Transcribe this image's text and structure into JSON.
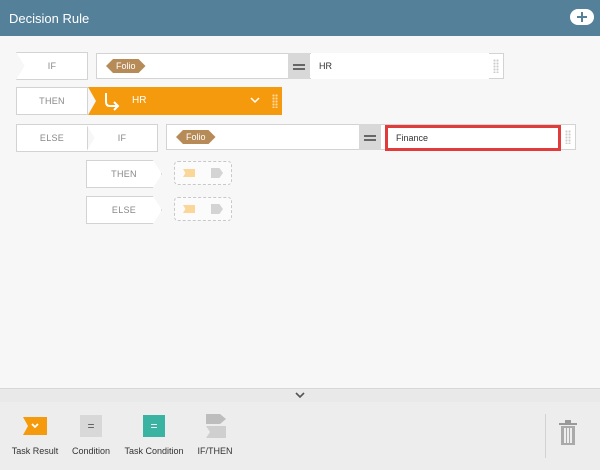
{
  "header": {
    "title": "Decision Rule",
    "add_button_icon": "plus-icon"
  },
  "rule": {
    "if_label": "IF",
    "then_label": "THEN",
    "else_label": "ELSE",
    "condition1": {
      "field": "Folio",
      "operator": "=",
      "value": "HR"
    },
    "then_result": "HR",
    "nested": {
      "if_label": "IF",
      "then_label": "THEN",
      "else_label": "ELSE",
      "condition": {
        "field": "Folio",
        "operator": "=",
        "value": "Finance"
      }
    }
  },
  "toolbox": {
    "items": [
      {
        "label": "Task Result",
        "icon": "task-result-icon",
        "color": "#f59a0c"
      },
      {
        "label": "Condition",
        "icon": "condition-icon",
        "color": "#d8d8d8"
      },
      {
        "label": "Task Condition",
        "icon": "task-condition-icon",
        "color": "#3bb3a3"
      },
      {
        "label": "IF/THEN",
        "icon": "if-then-icon",
        "color": "#bdbdbd"
      }
    ],
    "delete_icon": "trash-icon"
  },
  "colors": {
    "header": "#54809a",
    "accent": "#f59a0c",
    "highlight": "#e23b3b",
    "tag": "#b78b57"
  }
}
